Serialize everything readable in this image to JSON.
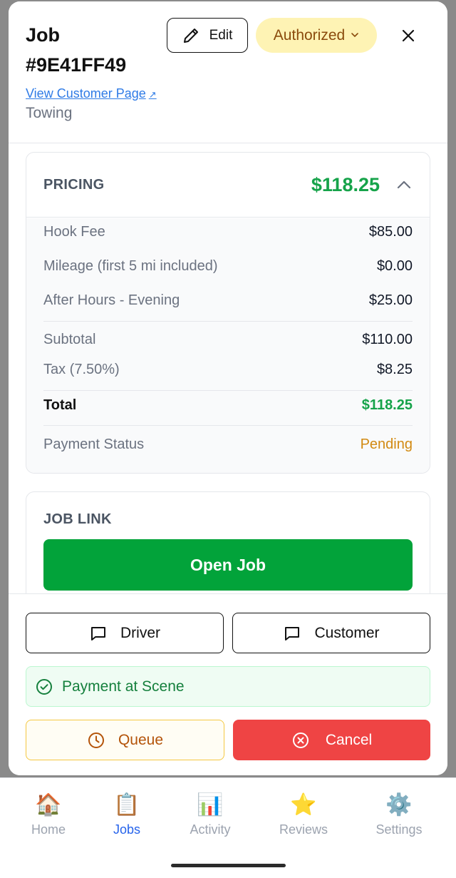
{
  "header": {
    "job_title": "Job #9E41FF49",
    "customer_link": "View Customer Page",
    "customer_link_icon": "↗",
    "service_type": "Towing",
    "edit_label": "Edit",
    "status_label": "Authorized",
    "status_chevron": "⌄",
    "close_icon": "×"
  },
  "pricing": {
    "section_label": "PRICING",
    "total_header": "$118.25",
    "line_items": [
      {
        "label": "Hook Fee",
        "value": "$85.00"
      },
      {
        "label": "Mileage (first 5 mi included)",
        "value": "$0.00"
      },
      {
        "label": "After Hours - Evening",
        "value": "$25.00"
      }
    ],
    "subtotal": {
      "label": "Subtotal",
      "value": "$110.00"
    },
    "tax": {
      "label": "Tax (7.50%)",
      "value": "$8.25"
    },
    "total": {
      "label": "Total",
      "value": "$118.25"
    },
    "payment_status": {
      "label": "Payment Status",
      "value": "Pending"
    }
  },
  "job_link": {
    "section_label": "JOB LINK",
    "open_label": "Open Job"
  },
  "actions": {
    "driver_label": "Driver",
    "customer_label": "Customer",
    "payment_banner": "Payment at Scene",
    "queue_label": "Queue",
    "cancel_label": "Cancel"
  },
  "tabs": [
    {
      "label": "Home",
      "icon": "🏠",
      "icon_name": "house-icon"
    },
    {
      "label": "Jobs",
      "icon": "📋",
      "icon_name": "clipboard-icon",
      "active": true
    },
    {
      "label": "Activity",
      "icon": "📊",
      "icon_name": "bar-chart-icon"
    },
    {
      "label": "Reviews",
      "icon": "⭐",
      "icon_name": "star-icon"
    },
    {
      "label": "Settings",
      "icon": "⚙️",
      "icon_name": "gear-icon"
    }
  ],
  "colors": {
    "accent_green": "#16a34a",
    "button_green": "#02a33a",
    "cancel_red": "#ef4444",
    "pending_amber": "#d28a12",
    "status_pill_bg": "#fef3b4",
    "active_tab_blue": "#2563eb"
  }
}
